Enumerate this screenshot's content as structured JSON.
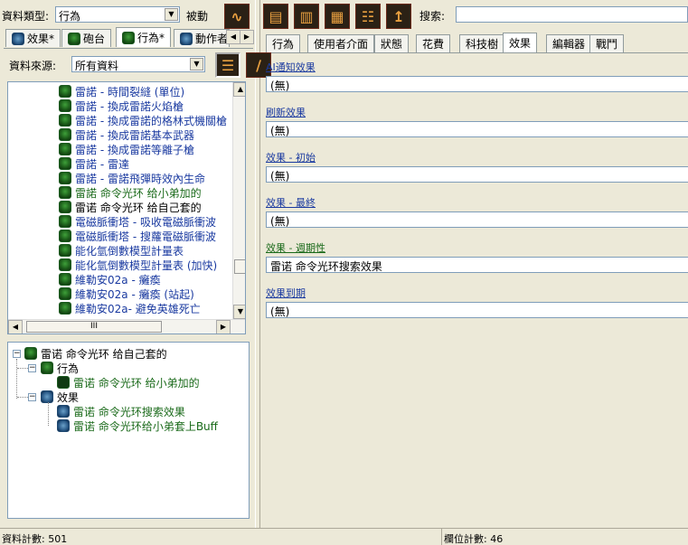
{
  "left": {
    "data_type_label": "資料類型:",
    "data_type_value": "行為",
    "passive_label": "被動",
    "tabs": [
      {
        "label": "效果*"
      },
      {
        "label": "砲台"
      },
      {
        "label": "行為*"
      },
      {
        "label": "動作者"
      }
    ],
    "source_label": "資料來源:",
    "source_value": "所有資料",
    "list_items": [
      {
        "text": "雷諾 - 時間裂縫 (單位)"
      },
      {
        "text": "雷諾 - 換成雷諾火焰槍"
      },
      {
        "text": "雷諾 - 換成雷諾的格林式機關槍"
      },
      {
        "text": "雷諾 - 換成雷諾基本武器"
      },
      {
        "text": "雷諾 - 換成雷諾等離子槍"
      },
      {
        "text": "雷諾 - 雷達"
      },
      {
        "text": "雷諾 - 雷諾飛彈時效內生命"
      },
      {
        "text": "雷諾 命令光环 给小弟加的"
      },
      {
        "text": "雷诺 命令光环 给自己套的"
      },
      {
        "text": "電磁脈衝塔 - 吸收電磁脈衝波"
      },
      {
        "text": "電磁脈衝塔 - 搜蘿電磁脈衝波"
      },
      {
        "text": "能化氫倒數模型計量表"
      },
      {
        "text": "能化氫倒數模型計量表 (加快)"
      },
      {
        "text": "維勒安02a - 癱瘓"
      },
      {
        "text": "維勒安02a - 癱瘓 (站起)"
      },
      {
        "text": "維勒安02a- 避免英雄死亡"
      }
    ],
    "hscroll_label": "III",
    "tree": {
      "root": "雷诺 命令光环 给自己套的",
      "behaviors_label": "行為",
      "behavior_item": "雷诺 命令光环 给小弟加的",
      "effects_label": "效果",
      "effect_items": [
        "雷诺 命令光环搜索效果",
        "雷诺 命令光环给小弟套上Buff"
      ]
    }
  },
  "right": {
    "search_label": "搜索:",
    "search_value": "",
    "tabs": [
      {
        "label": "行為"
      },
      {
        "label": "使用者介面"
      },
      {
        "label": "狀態"
      },
      {
        "label": "花費"
      },
      {
        "label": "科技樹"
      },
      {
        "label": "效果"
      },
      {
        "label": "編輯器"
      },
      {
        "label": "戰鬥"
      }
    ],
    "fields": [
      {
        "label": "AI通知效果",
        "value": "(無)"
      },
      {
        "label": "刷新效果",
        "value": "(無)"
      },
      {
        "label": "效果 - 初始",
        "value": "(無)"
      },
      {
        "label": "效果 - 最終",
        "value": "(無)"
      },
      {
        "label": "效果 - 週期性",
        "value": "雷诺 命令光环搜索效果"
      },
      {
        "label": "效果到期",
        "value": "(無)"
      }
    ]
  },
  "status": {
    "record_count": "資料計數: 501",
    "field_count": "欄位計數: 46"
  },
  "colors": {
    "link_blue": "#1a3aa0",
    "modified_green": "#1a6a1a",
    "window_bg": "#ece9d8"
  }
}
